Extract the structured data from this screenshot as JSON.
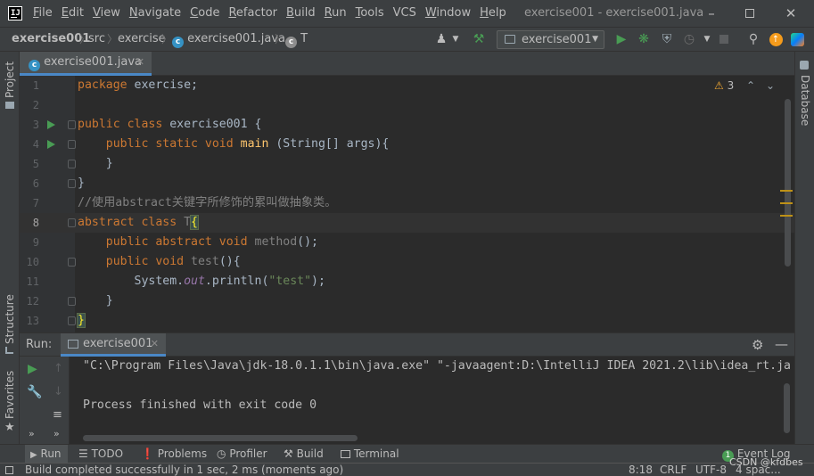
{
  "menubar": {
    "items": [
      {
        "label": "File",
        "ul": "F",
        "rest": "ile"
      },
      {
        "label": "Edit",
        "ul": "E",
        "rest": "dit"
      },
      {
        "label": "View",
        "ul": "V",
        "rest": "iew"
      },
      {
        "label": "Navigate",
        "ul": "N",
        "rest": "avigate"
      },
      {
        "label": "Code",
        "ul": "C",
        "rest": "ode"
      },
      {
        "label": "Refactor",
        "ul": "R",
        "rest": "efactor"
      },
      {
        "label": "Build",
        "ul": "B",
        "rest": "uild"
      },
      {
        "label": "Run",
        "ul": "R",
        "rest": "un"
      },
      {
        "label": "Tools",
        "ul": "T",
        "rest": "ools"
      },
      {
        "label": "VCS",
        "ul": "",
        "rest": "VCS"
      },
      {
        "label": "Window",
        "ul": "W",
        "rest": "indow"
      },
      {
        "label": "Help",
        "ul": "H",
        "rest": "elp"
      }
    ],
    "window_title": "exercise001 - exercise001.java",
    "logo_text": "IJ"
  },
  "breadcrumb": {
    "project": "exercise001",
    "folder": "src",
    "package": "exercise",
    "file": "exercise001.java",
    "class": "T"
  },
  "toolbar": {
    "run_config": "exercise001"
  },
  "left_strip": {
    "project": "Project",
    "structure": "Structure",
    "favorites": "Favorites"
  },
  "right_strip": {
    "database": "Database"
  },
  "editor": {
    "tab_label": "exercise001.java",
    "warning_count": "3",
    "current_line": 8,
    "lines": [
      {
        "n": "1",
        "text": "package exercise;"
      },
      {
        "n": "2",
        "text": ""
      },
      {
        "n": "3",
        "text": "public class exercise001 {"
      },
      {
        "n": "4",
        "text": "    public static void main (String[] args){"
      },
      {
        "n": "5",
        "text": "    }"
      },
      {
        "n": "6",
        "text": "}"
      },
      {
        "n": "7",
        "text": "//使用abstract关键字所修饰的累叫做抽象类。"
      },
      {
        "n": "8",
        "text": "abstract class T{"
      },
      {
        "n": "9",
        "text": "    public abstract void method();"
      },
      {
        "n": "10",
        "text": "    public void test(){"
      },
      {
        "n": "11",
        "text": "        System.out.println(\"test\");"
      },
      {
        "n": "12",
        "text": "    }"
      },
      {
        "n": "13",
        "text": "}"
      }
    ]
  },
  "run_panel": {
    "label": "Run:",
    "tab_label": "exercise001",
    "console_lines": [
      "\"C:\\Program Files\\Java\\jdk-18.0.1.1\\bin\\java.exe\" \"-javaagent:D:\\IntelliJ IDEA 2021.2\\lib\\idea_rt.ja",
      "",
      "Process finished with exit code 0"
    ]
  },
  "tool_tabs": {
    "run": "Run",
    "todo": "TODO",
    "problems": "Problems",
    "profiler": "Profiler",
    "build": "Build",
    "terminal": "Terminal",
    "event_log": "Event Log",
    "event_count": "1"
  },
  "status_bar": {
    "message": "Build completed successfully in 1 sec, 2 ms (moments ago)",
    "position": "8:18",
    "line_sep": "CRLF",
    "encoding": "UTF-8",
    "indent": "4 spac...",
    "watermark": "CSDN @kfdbes"
  },
  "colors": {
    "keyword": "#cc7832",
    "string": "#6a8759",
    "method_decl": "#ffc66d",
    "static_field": "#9876aa",
    "run_green": "#499c54",
    "accent_blue": "#4a88c7"
  }
}
